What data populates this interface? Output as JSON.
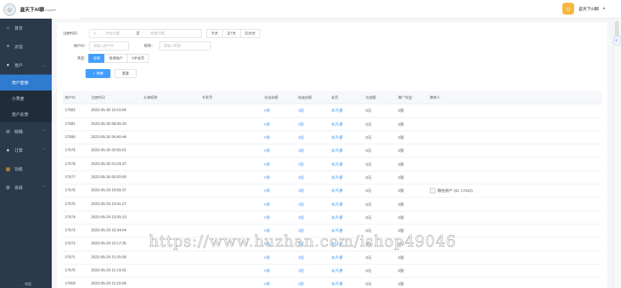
{
  "brand": {
    "name": "盗天下AI聊",
    "suffix": "-ChatGPT"
  },
  "user": {
    "name": "盗天下AI聊"
  },
  "sidebar": {
    "items": [
      {
        "label": "首页",
        "icon": "home-icon"
      },
      {
        "label": "对话",
        "icon": "list-icon"
      },
      {
        "label": "用户",
        "icon": "user-icon"
      }
    ],
    "sub": [
      "用户管理",
      "小黑屋",
      "用户反馈"
    ],
    "items2": [
      {
        "label": "邮箱",
        "icon": "mail-icon"
      },
      {
        "label": "订单",
        "icon": "cart-icon"
      },
      {
        "label": "功能",
        "icon": "grid-icon"
      },
      {
        "label": "系统",
        "icon": "gear-icon"
      }
    ],
    "bottom": "收起"
  },
  "filters": {
    "reg_time_label": "注册时间：",
    "start_placeholder": "开始日期",
    "range_sep": "至",
    "end_placeholder": "结束日期",
    "quick": [
      "今天",
      "近7天",
      "近30天"
    ],
    "uid_label": "用户ID：",
    "uid_placeholder": "请输入用户ID",
    "nick_label": "昵称：",
    "nick_placeholder": "请输入昵称",
    "type_label": "类型：",
    "types": [
      "全部",
      "普通用户",
      "VIP会员"
    ],
    "search_btn": "✓ 搜索",
    "reset_btn": "重置"
  },
  "table": {
    "headers": [
      "用户ID",
      "注册时间",
      "头像昵称",
      "手机号",
      "对话余额",
      "绘画余额",
      "会员",
      "充值额",
      "推广收益",
      "推荐人"
    ],
    "rows": [
      {
        "id": "17582",
        "time": "2023-05-30 10:16:56",
        "chat": "5条",
        "draw": "3张",
        "vip": "未开通",
        "recharge": "0元",
        "earn": "0张",
        "ref": ""
      },
      {
        "id": "17581",
        "time": "2023-05-30 08:36:20",
        "chat": "5条",
        "draw": "3张",
        "vip": "未开通",
        "recharge": "0元",
        "earn": "0张",
        "ref": ""
      },
      {
        "id": "17580",
        "time": "2023-05-30 06:40:44",
        "chat": "5条",
        "draw": "3张",
        "vip": "未开通",
        "recharge": "0元",
        "earn": "0张",
        "ref": ""
      },
      {
        "id": "17579",
        "time": "2023-05-30 02:55:01",
        "chat": "5条",
        "draw": "3张",
        "vip": "未开通",
        "recharge": "0元",
        "earn": "0张",
        "ref": ""
      },
      {
        "id": "17578",
        "time": "2023-05-30 01:09:37",
        "chat": "5条",
        "draw": "3张",
        "vip": "未开通",
        "recharge": "0元",
        "earn": "0张",
        "ref": ""
      },
      {
        "id": "17577",
        "time": "2023-05-30 00:20:00",
        "chat": "5条",
        "draw": "3张",
        "vip": "未开通",
        "recharge": "0元",
        "earn": "0张",
        "ref": ""
      },
      {
        "id": "17576",
        "time": "2023-05-29 23:55:37",
        "chat": "5条",
        "draw": "3张",
        "vip": "未开通",
        "recharge": "0元",
        "earn": "0张",
        "ref": "微信用户 (ID: 17410)"
      },
      {
        "id": "17575",
        "time": "2023-05-29 23:41:27",
        "chat": "5条",
        "draw": "3张",
        "vip": "未开通",
        "recharge": "0元",
        "earn": "0张",
        "ref": ""
      },
      {
        "id": "17574",
        "time": "2023-05-29 23:26:13",
        "chat": "5条",
        "draw": "3张",
        "vip": "未开通",
        "recharge": "0元",
        "earn": "0张",
        "ref": ""
      },
      {
        "id": "17573",
        "time": "2023-05-29 22:34:04",
        "chat": "5条",
        "draw": "3张",
        "vip": "未开通",
        "recharge": "0元",
        "earn": "0张",
        "ref": ""
      },
      {
        "id": "17572",
        "time": "2023-05-29 22:17:26",
        "chat": "5条",
        "draw": "3张",
        "vip": "未开通",
        "recharge": "0元",
        "earn": "0张",
        "ref": ""
      },
      {
        "id": "17571",
        "time": "2023-05-29 21:25:00",
        "chat": "5条",
        "draw": "3张",
        "vip": "未开通",
        "recharge": "0元",
        "earn": "0张",
        "ref": ""
      },
      {
        "id": "17570",
        "time": "2023-05-29 21:19:02",
        "chat": "5条",
        "draw": "3张",
        "vip": "未开通",
        "recharge": "0元",
        "earn": "0张",
        "ref": ""
      },
      {
        "id": "17569",
        "time": "2023-05-29 21:16:09",
        "chat": "5条",
        "draw": "3张",
        "vip": "未开通",
        "recharge": "0元",
        "earn": "0张",
        "ref": ""
      }
    ]
  },
  "watermark": "https://www.huzhan.com/ishop49046",
  "colors": {
    "sidebar": "#2b3a4a",
    "accent": "#409eff",
    "avatar": "#f6b73c"
  }
}
